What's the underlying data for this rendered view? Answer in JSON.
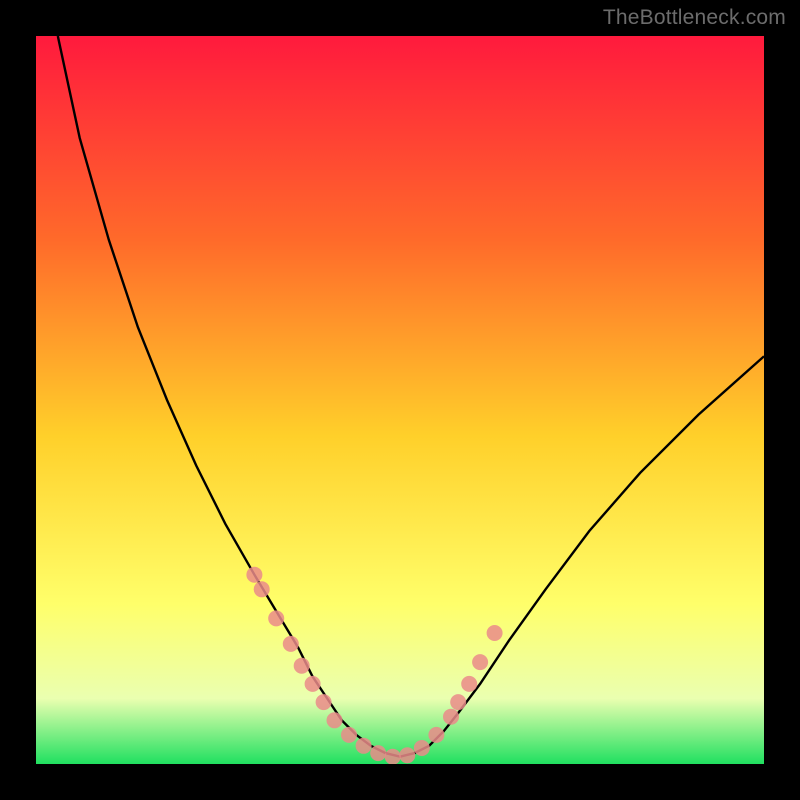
{
  "attribution": {
    "watermark": "TheBottleneck.com"
  },
  "chart_data": {
    "type": "line",
    "title": "",
    "xlabel": "",
    "ylabel": "",
    "xlim": [
      0,
      100
    ],
    "ylim": [
      0,
      100
    ],
    "grid": false,
    "legend": false,
    "background_gradient": {
      "top": "#ff1a3d",
      "upper_mid": "#ff6a2a",
      "mid": "#ffd02a",
      "lower_mid": "#ffff6a",
      "lower": "#eaffb0",
      "bottom": "#20e060"
    },
    "series": [
      {
        "name": "bottleneck-curve",
        "color": "#000000",
        "x": [
          3,
          6,
          10,
          14,
          18,
          22,
          26,
          30,
          33,
          36,
          38,
          40,
          42,
          44,
          46,
          48,
          50,
          52,
          54,
          56,
          58,
          61,
          65,
          70,
          76,
          83,
          91,
          100
        ],
        "y": [
          100,
          86,
          72,
          60,
          50,
          41,
          33,
          26,
          21,
          16,
          12,
          9,
          6,
          4,
          2.5,
          1.5,
          1,
          1.5,
          2.5,
          4.5,
          7,
          11,
          17,
          24,
          32,
          40,
          48,
          56
        ]
      }
    ],
    "markers": {
      "name": "highlight-points",
      "color": "#ea8b8a",
      "radius_px": 8,
      "points_xy": [
        [
          30,
          26
        ],
        [
          31,
          24
        ],
        [
          33,
          20
        ],
        [
          35,
          16.5
        ],
        [
          36.5,
          13.5
        ],
        [
          38,
          11
        ],
        [
          39.5,
          8.5
        ],
        [
          41,
          6
        ],
        [
          43,
          4
        ],
        [
          45,
          2.5
        ],
        [
          47,
          1.5
        ],
        [
          49,
          1
        ],
        [
          51,
          1.2
        ],
        [
          53,
          2.2
        ],
        [
          55,
          4
        ],
        [
          57,
          6.5
        ],
        [
          58,
          8.5
        ],
        [
          59.5,
          11
        ],
        [
          61,
          14
        ],
        [
          63,
          18
        ]
      ]
    }
  }
}
